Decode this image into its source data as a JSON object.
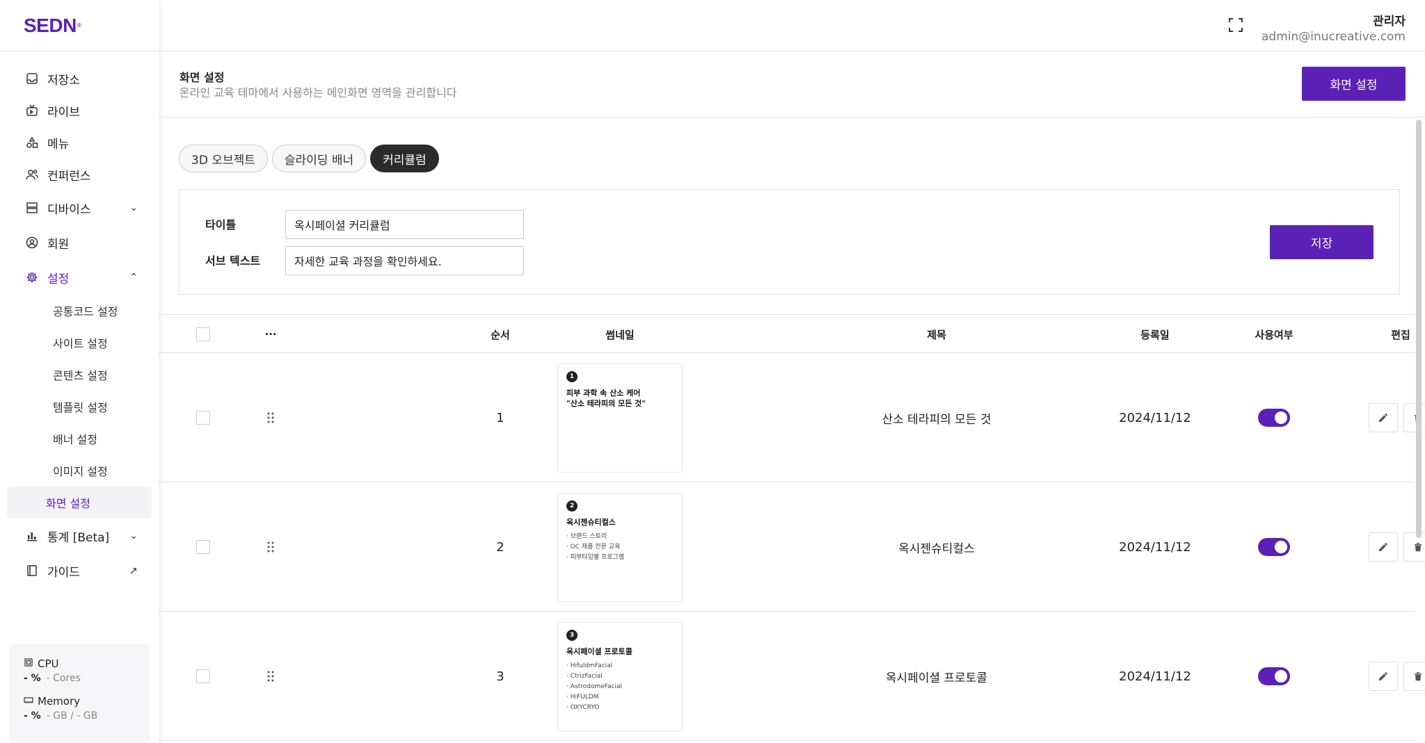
{
  "brand": {
    "logo": "SEDN"
  },
  "sidebar": {
    "items": [
      {
        "label": "저장소",
        "icon": "inbox-icon"
      },
      {
        "label": "라이브",
        "icon": "tv-icon"
      },
      {
        "label": "메뉴",
        "icon": "shapes-icon"
      },
      {
        "label": "컨퍼런스",
        "icon": "users-icon"
      },
      {
        "label": "디바이스",
        "icon": "server-icon"
      },
      {
        "label": "회원",
        "icon": "user-circle-icon"
      },
      {
        "label": "설정",
        "icon": "gear-icon"
      },
      {
        "label": "통계 [Beta]",
        "icon": "bar-chart-icon"
      },
      {
        "label": "가이드",
        "icon": "book-icon"
      }
    ],
    "settings_sub": [
      "공통코드 설정",
      "사이트 설정",
      "콘텐츠 설정",
      "템플릿 설정",
      "배너 설정",
      "이미지 설정",
      "화면 설정"
    ],
    "system": {
      "cpu_label": "CPU",
      "cpu_value": "- %",
      "cpu_sub": "- Cores",
      "mem_label": "Memory",
      "mem_value": "- %",
      "mem_sub": "- GB / - GB"
    }
  },
  "header": {
    "user_name": "관리자",
    "user_email": "admin@inucreative.com"
  },
  "page": {
    "title": "화면 설정",
    "description": "온라인 교육 테마에서 사용하는 메인화면 영역을 관리합니다",
    "action_label": "화면 설정"
  },
  "tabs": [
    "3D 오브젝트",
    "슬라이딩 배너",
    "커리큘럼"
  ],
  "form": {
    "title_label": "타이틀",
    "title_value": "옥시페이셜 커리큘럼",
    "sub_label": "서브 텍스트",
    "sub_value": "자세한 교육 과정을 확인하세요.",
    "save_label": "저장"
  },
  "table": {
    "headers": {
      "more": "···",
      "order": "순서",
      "thumb": "썸네일",
      "title": "제목",
      "date": "등록일",
      "use": "사용여부",
      "edit": "편집"
    },
    "rows": [
      {
        "order": "1",
        "thumb_num": "1",
        "thumb_head": "피부 과학 속 산소 케어\n\"산소 테라피의 모든 것\"",
        "thumb_items": [],
        "title": "산소 테라피의 모든 것",
        "date": "2024/11/12"
      },
      {
        "order": "2",
        "thumb_num": "2",
        "thumb_head": "옥시젠슈티컬스",
        "thumb_items": [
          "· 브랜드 스토리",
          "· OC 제품 전문 교육",
          "· 피부타입별 프로그램"
        ],
        "title": "옥시젠슈티컬스",
        "date": "2024/11/12"
      },
      {
        "order": "3",
        "thumb_num": "3",
        "thumb_head": "옥시페이셜 프로토콜",
        "thumb_items": [
          "· HifuldmFacial",
          "· CtrizFacial",
          "· AstrodomeFacial",
          "· HiFULDM",
          "· OXYCRYO"
        ],
        "title": "옥시페이셜 프로토콜",
        "date": "2024/11/12"
      }
    ]
  },
  "colors": {
    "accent": "#5b21b6",
    "tab_active": "#2b2b2b"
  }
}
